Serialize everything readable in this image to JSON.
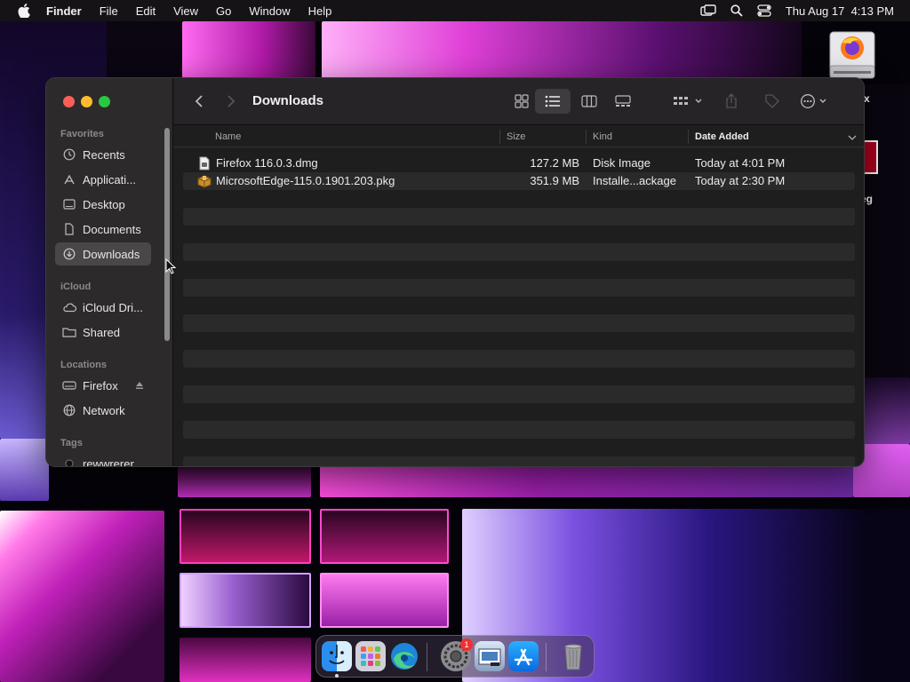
{
  "menubar": {
    "app_name": "Finder",
    "menus": [
      "File",
      "Edit",
      "View",
      "Go",
      "Window",
      "Help"
    ],
    "clock": "Thu Aug 17  4:13 PM"
  },
  "desktop": {
    "icons": [
      {
        "label": "x",
        "icon": "firefox-disk-icon"
      },
      {
        "label": "eg",
        "icon": "edge-pkg-icon"
      }
    ]
  },
  "finder": {
    "title": "Downloads",
    "sidebar": {
      "sections": [
        {
          "title": "Favorites",
          "items": [
            {
              "label": "Recents",
              "icon": "clock-icon"
            },
            {
              "label": "Applicati...",
              "icon": "applications-icon"
            },
            {
              "label": "Desktop",
              "icon": "desktop-icon"
            },
            {
              "label": "Documents",
              "icon": "document-icon"
            },
            {
              "label": "Downloads",
              "icon": "download-icon",
              "selected": true
            }
          ]
        },
        {
          "title": "iCloud",
          "items": [
            {
              "label": "iCloud Dri...",
              "icon": "cloud-icon"
            },
            {
              "label": "Shared",
              "icon": "shared-folder-icon"
            }
          ]
        },
        {
          "title": "Locations",
          "items": [
            {
              "label": "Firefox",
              "icon": "drive-icon",
              "eject": true
            },
            {
              "label": "Network",
              "icon": "globe-icon"
            }
          ]
        },
        {
          "title": "Tags",
          "items": [
            {
              "label": "rewwrerer",
              "icon": "tag-dot-icon"
            }
          ]
        }
      ]
    },
    "columns": {
      "name": "Name",
      "size": "Size",
      "kind": "Kind",
      "date_added": "Date Added"
    },
    "files": [
      {
        "name": "Firefox 116.0.3.dmg",
        "size": "127.2 MB",
        "kind": "Disk Image",
        "date_added": "Today at 4:01 PM",
        "icon": "disk-image-icon"
      },
      {
        "name": "MicrosoftEdge-115.0.1901.203.pkg",
        "size": "351.9 MB",
        "kind": "Installe...ackage",
        "date_added": "Today at 2:30 PM",
        "icon": "package-icon"
      }
    ]
  },
  "dock": {
    "apps": [
      "Finder",
      "Launchpad",
      "Microsoft Edge",
      "System Settings",
      "Preview",
      "App Store",
      "Trash"
    ],
    "settings_badge": "1"
  }
}
